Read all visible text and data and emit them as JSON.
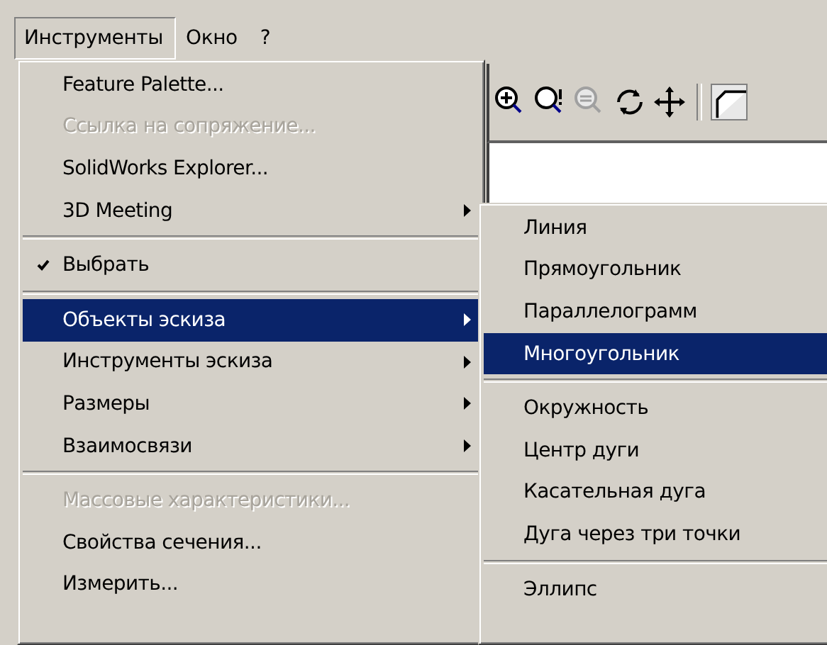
{
  "menu_bar": [
    {
      "label": "Инструменты",
      "selected": true
    },
    {
      "label": "Окно",
      "selected": false
    },
    {
      "label": "?",
      "selected": false
    }
  ],
  "toolbar": [
    {
      "kind": "zoom-in",
      "disabled": false
    },
    {
      "kind": "zoom-fit",
      "disabled": false
    },
    {
      "kind": "zoom-out",
      "disabled": true
    },
    {
      "kind": "rotate",
      "disabled": false
    },
    {
      "kind": "pan",
      "disabled": false
    },
    {
      "kind": "separator"
    },
    {
      "kind": "view",
      "disabled": false
    }
  ],
  "tools_menu": [
    {
      "kind": "item",
      "label": "Feature Palette...",
      "disabled": false,
      "checked": false,
      "selected": false,
      "submenu": false
    },
    {
      "kind": "item",
      "label": "Ссылка на сопряжение...",
      "disabled": true,
      "checked": false,
      "selected": false,
      "submenu": false
    },
    {
      "kind": "item",
      "label": "SolidWorks Explorer...",
      "disabled": false,
      "checked": false,
      "selected": false,
      "submenu": false
    },
    {
      "kind": "item",
      "label": "3D Meeting",
      "disabled": false,
      "checked": false,
      "selected": false,
      "submenu": true
    },
    {
      "kind": "separator"
    },
    {
      "kind": "item",
      "label": "Выбрать",
      "disabled": false,
      "checked": true,
      "selected": false,
      "submenu": false
    },
    {
      "kind": "separator"
    },
    {
      "kind": "item",
      "label": "Объекты эскиза",
      "disabled": false,
      "checked": false,
      "selected": true,
      "submenu": true
    },
    {
      "kind": "item",
      "label": "Инструменты эскиза",
      "disabled": false,
      "checked": false,
      "selected": false,
      "submenu": true
    },
    {
      "kind": "item",
      "label": "Размеры",
      "disabled": false,
      "checked": false,
      "selected": false,
      "submenu": true
    },
    {
      "kind": "item",
      "label": "Взаимосвязи",
      "disabled": false,
      "checked": false,
      "selected": false,
      "submenu": true
    },
    {
      "kind": "separator"
    },
    {
      "kind": "item",
      "label": "Массовые характеристики...",
      "disabled": true,
      "checked": false,
      "selected": false,
      "submenu": false
    },
    {
      "kind": "item",
      "label": "Свойства сечения...",
      "disabled": false,
      "checked": false,
      "selected": false,
      "submenu": false
    },
    {
      "kind": "item",
      "label": "Измерить...",
      "disabled": false,
      "checked": false,
      "selected": false,
      "submenu": false
    }
  ],
  "sketch_entities_submenu": [
    {
      "kind": "item",
      "label": "Линия",
      "selected": false
    },
    {
      "kind": "item",
      "label": "Прямоугольник",
      "selected": false
    },
    {
      "kind": "item",
      "label": "Параллелограмм",
      "selected": false
    },
    {
      "kind": "item",
      "label": "Многоугольник",
      "selected": true
    },
    {
      "kind": "separator"
    },
    {
      "kind": "item",
      "label": "Окружность",
      "selected": false
    },
    {
      "kind": "item",
      "label": "Центр дуги",
      "selected": false
    },
    {
      "kind": "item",
      "label": "Касательная дуга",
      "selected": false
    },
    {
      "kind": "item",
      "label": "Дуга через три точки",
      "selected": false
    },
    {
      "kind": "separator"
    },
    {
      "kind": "item",
      "label": "Эллипс",
      "selected": false
    }
  ]
}
